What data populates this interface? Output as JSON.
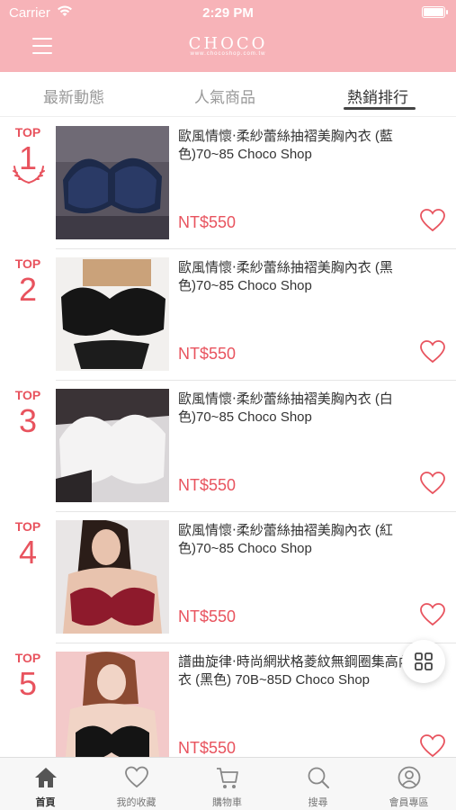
{
  "status_bar": {
    "carrier": "Carrier",
    "time": "2:29 PM"
  },
  "header": {
    "logo": "CHOCO",
    "logo_sub": "www.chocoshop.com.tw",
    "menu_icon": "hamburger-icon"
  },
  "tabs": [
    {
      "label": "最新動態",
      "active": false
    },
    {
      "label": "人氣商品",
      "active": false
    },
    {
      "label": "熱銷排行",
      "active": true
    }
  ],
  "ranking": [
    {
      "top": "TOP",
      "rank": "1",
      "title": "歐風情懷‧柔紗蕾絲抽褶美胸內衣 (藍色)70~85 Choco Shop",
      "price": "NT$550",
      "image": "navy-lace-bra-photo"
    },
    {
      "top": "TOP",
      "rank": "2",
      "title": "歐風情懷‧柔紗蕾絲抽褶美胸內衣 (黑色)70~85 Choco Shop",
      "price": "NT$550",
      "image": "black-lace-bra-photo"
    },
    {
      "top": "TOP",
      "rank": "3",
      "title": "歐風情懷‧柔紗蕾絲抽褶美胸內衣 (白色)70~85 Choco Shop",
      "price": "NT$550",
      "image": "white-lace-bra-photo"
    },
    {
      "top": "TOP",
      "rank": "4",
      "title": "歐風情懷‧柔紗蕾絲抽褶美胸內衣 (紅色)70~85 Choco Shop",
      "price": "NT$550",
      "image": "model-red-bra-photo"
    },
    {
      "top": "TOP",
      "rank": "5",
      "title": "譜曲旋律‧時尚網狀格菱紋無鋼圈集高內衣 (黑色) 70B~85D Choco Shop",
      "price": "NT$550",
      "image": "model-black-bra-photo"
    }
  ],
  "fab": {
    "icon": "grid-icon"
  },
  "bottom_nav": [
    {
      "label": "首頁",
      "icon": "home-icon",
      "active": true
    },
    {
      "label": "我的收藏",
      "icon": "heart-icon",
      "active": false
    },
    {
      "label": "購物車",
      "icon": "cart-icon",
      "active": false
    },
    {
      "label": "搜尋",
      "icon": "search-icon",
      "active": false
    },
    {
      "label": "會員專區",
      "icon": "user-icon",
      "active": false
    }
  ],
  "colors": {
    "header_bg": "#f7b3b8",
    "accent": "#e8535e",
    "nav_bg": "#f7f7f7"
  }
}
